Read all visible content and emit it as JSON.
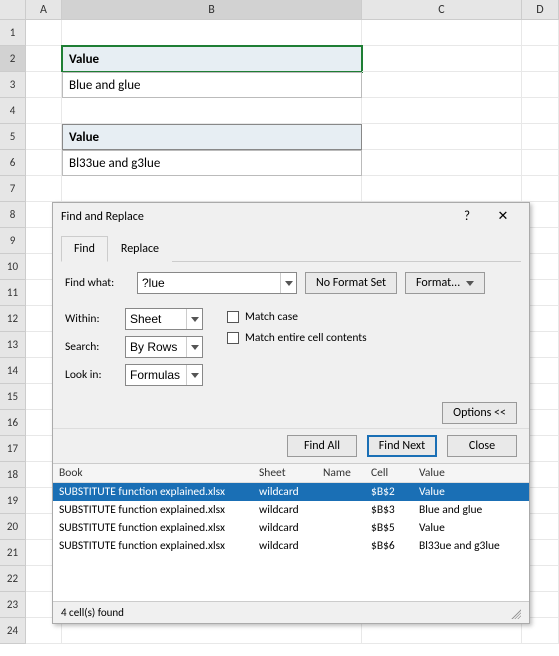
{
  "columns": [
    "A",
    "B",
    "C",
    "D"
  ],
  "rows": 24,
  "active_row": 2,
  "cells": {
    "b2": "Value",
    "b3": "Blue and glue",
    "b5": "Value",
    "b6": "Bl33ue and g3lue"
  },
  "dialog": {
    "title": "Find and Replace",
    "tabs": {
      "find": "Find",
      "replace": "Replace"
    },
    "labels": {
      "find_what": "Find what:",
      "within": "Within:",
      "search": "Search:",
      "look_in": "Look in:",
      "no_format": "No Format Set",
      "format_btn": "Format...",
      "match_case": "Match case",
      "match_entire": "Match entire cell contents",
      "options": "Options <<",
      "find_all": "Find All",
      "find_next": "Find Next",
      "close": "Close"
    },
    "values": {
      "find_what": "?lue",
      "within": "Sheet",
      "search": "By Rows",
      "look_in": "Formulas"
    },
    "results_headers": {
      "book": "Book",
      "sheet": "Sheet",
      "name": "Name",
      "cell": "Cell",
      "value": "Value"
    },
    "results": [
      {
        "book": "SUBSTITUTE function explained.xlsx",
        "sheet": "wildcard",
        "name": "",
        "cell": "$B$2",
        "value": "Value"
      },
      {
        "book": "SUBSTITUTE function explained.xlsx",
        "sheet": "wildcard",
        "name": "",
        "cell": "$B$3",
        "value": "Blue and glue"
      },
      {
        "book": "SUBSTITUTE function explained.xlsx",
        "sheet": "wildcard",
        "name": "",
        "cell": "$B$5",
        "value": "Value"
      },
      {
        "book": "SUBSTITUTE function explained.xlsx",
        "sheet": "wildcard",
        "name": "",
        "cell": "$B$6",
        "value": "Bl33ue and g3lue"
      }
    ],
    "status": "4 cell(s) found"
  }
}
